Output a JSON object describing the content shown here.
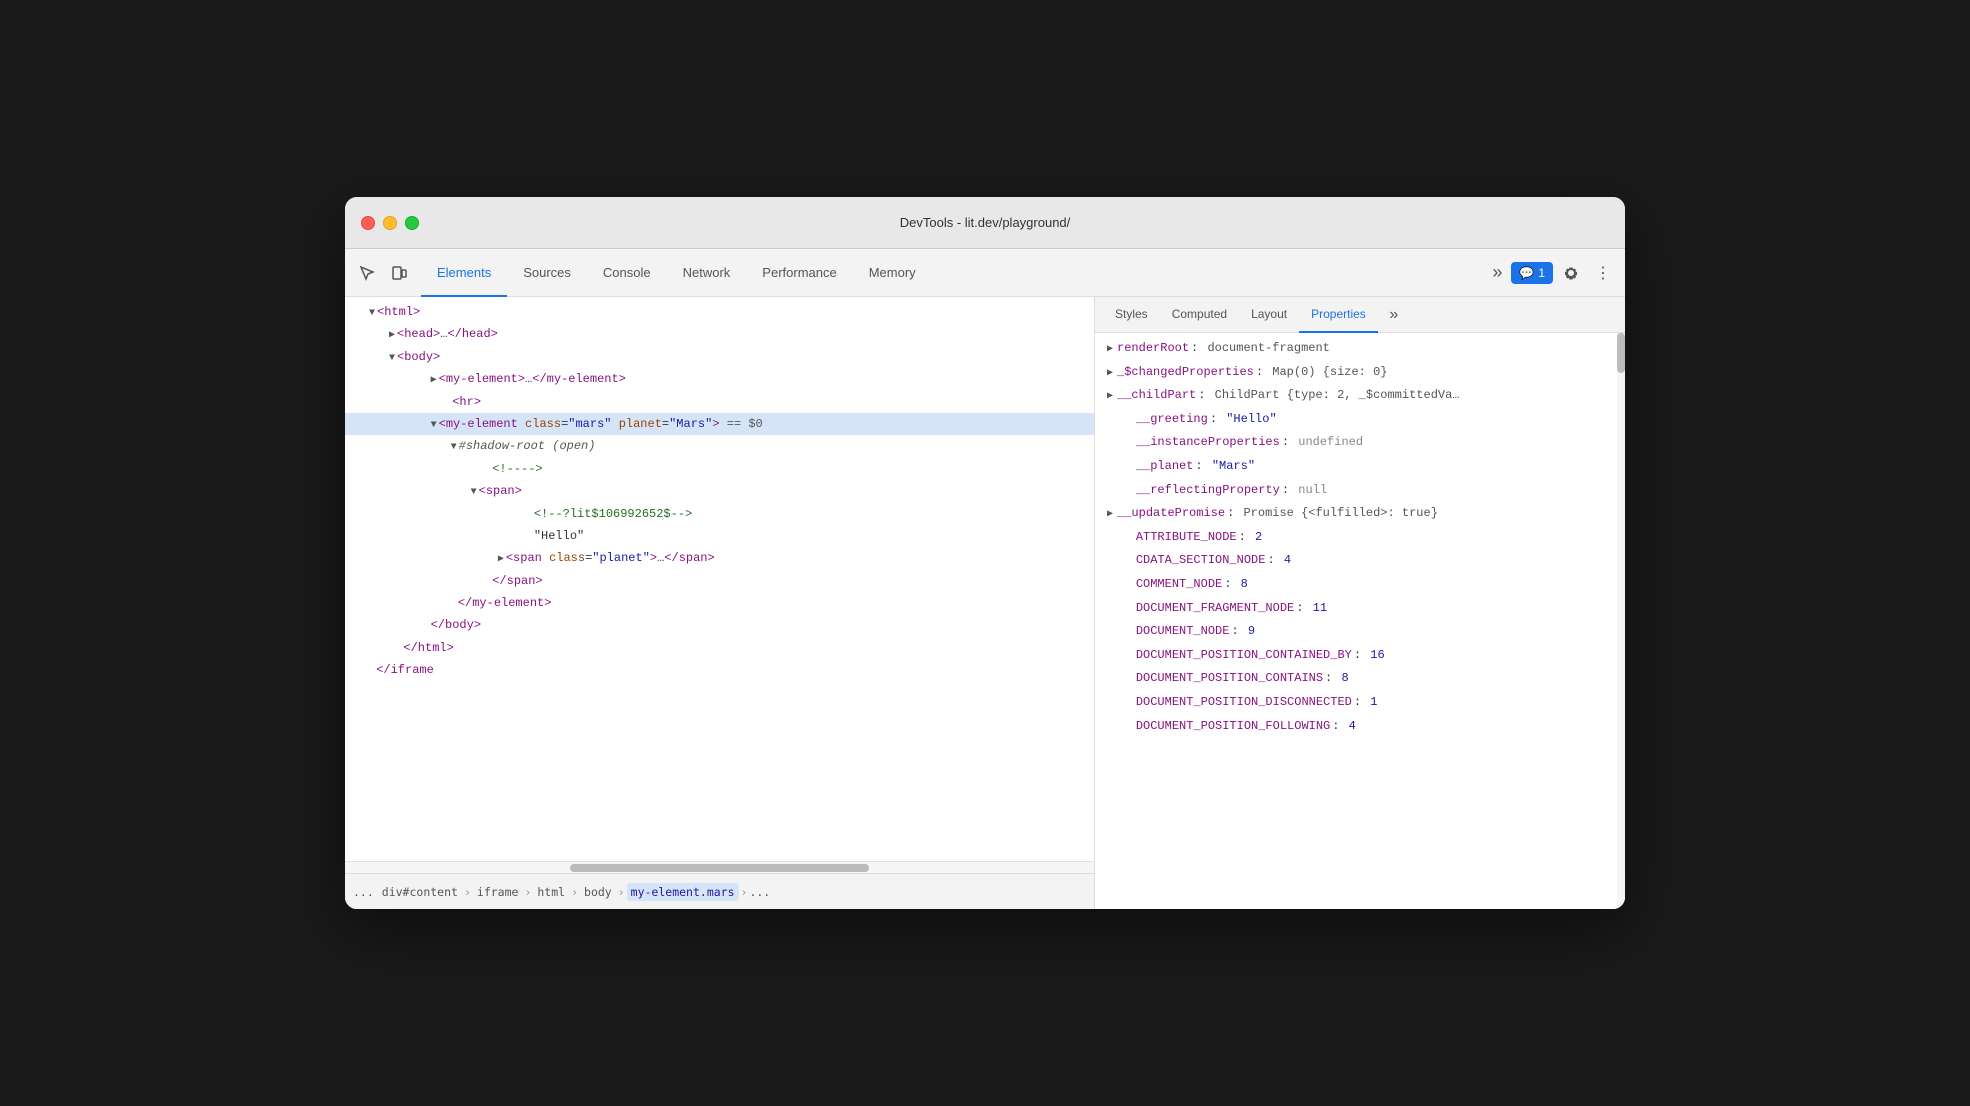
{
  "window": {
    "title": "DevTools - lit.dev/playground/"
  },
  "tabs": {
    "items": [
      {
        "label": "Elements",
        "active": true
      },
      {
        "label": "Sources"
      },
      {
        "label": "Console"
      },
      {
        "label": "Network"
      },
      {
        "label": "Performance"
      },
      {
        "label": "Memory"
      }
    ],
    "more_label": "»",
    "badge_label": "1",
    "badge_icon": "💬"
  },
  "panel_tabs": {
    "items": [
      {
        "label": "Styles"
      },
      {
        "label": "Computed"
      },
      {
        "label": "Layout"
      },
      {
        "label": "Properties",
        "active": true
      }
    ],
    "more_label": "»"
  },
  "dom_tree": [
    {
      "indent": 1,
      "content": "▼ <html>",
      "type": "tag"
    },
    {
      "indent": 2,
      "content": "▶ <head>…</head>",
      "type": "tag"
    },
    {
      "indent": 2,
      "content": "▼ <body>",
      "type": "tag"
    },
    {
      "indent": 3,
      "content": "▶ <my-element>…</my-element>",
      "type": "tag"
    },
    {
      "indent": 3,
      "content": "<hr>",
      "type": "tag"
    },
    {
      "indent": 3,
      "content": "▼ <my-element class=\"mars\" planet=\"Mars\"> == $0",
      "type": "selected"
    },
    {
      "indent": 4,
      "content": "▼ #shadow-root (open)",
      "type": "shadow"
    },
    {
      "indent": 5,
      "content": "<!---->",
      "type": "comment"
    },
    {
      "indent": 5,
      "content": "▼ <span>",
      "type": "tag"
    },
    {
      "indent": 6,
      "content": "<!--?lit$106992652$-->",
      "type": "comment"
    },
    {
      "indent": 6,
      "content": "\"Hello\"",
      "type": "text"
    },
    {
      "indent": 6,
      "content": "▶ <span class=\"planet\">…</span>",
      "type": "tag"
    },
    {
      "indent": 5,
      "content": "</span>",
      "type": "tag"
    },
    {
      "indent": 4,
      "content": "</my-element>",
      "type": "tag"
    },
    {
      "indent": 3,
      "content": "</body>",
      "type": "tag"
    },
    {
      "indent": 2,
      "content": "</html>",
      "type": "tag"
    },
    {
      "indent": 1,
      "content": "</iframe>",
      "type": "tag"
    }
  ],
  "breadcrumb": {
    "more": "...",
    "items": [
      {
        "label": "div#content"
      },
      {
        "label": "iframe"
      },
      {
        "label": "html"
      },
      {
        "label": "body"
      },
      {
        "label": "my-element.mars",
        "active": true
      },
      {
        "label": "..."
      }
    ]
  },
  "properties": [
    {
      "type": "expandable",
      "key": "renderRoot",
      "value": "document-fragment",
      "value_type": "obj"
    },
    {
      "type": "expandable",
      "key": "_$changedProperties",
      "value": "Map(0) {size: 0}",
      "value_type": "obj"
    },
    {
      "type": "expandable",
      "key": "__childPart",
      "value": "ChildPart {type: 2, _$committedVa…",
      "value_type": "obj"
    },
    {
      "type": "plain",
      "key": "__greeting",
      "value": "\"Hello\"",
      "value_type": "string"
    },
    {
      "type": "plain",
      "key": "__instanceProperties",
      "value": "undefined",
      "value_type": "null"
    },
    {
      "type": "plain",
      "key": "__planet",
      "value": "\"Mars\"",
      "value_type": "string"
    },
    {
      "type": "plain",
      "key": "__reflectingProperty",
      "value": "null",
      "value_type": "null"
    },
    {
      "type": "expandable",
      "key": "__updatePromise",
      "value": "Promise {<fulfilled>: true}",
      "value_type": "prom"
    },
    {
      "type": "plain",
      "key": "ATTRIBUTE_NODE",
      "value": "2",
      "value_type": "number"
    },
    {
      "type": "plain",
      "key": "CDATA_SECTION_NODE",
      "value": "4",
      "value_type": "number"
    },
    {
      "type": "plain",
      "key": "COMMENT_NODE",
      "value": "8",
      "value_type": "number"
    },
    {
      "type": "plain",
      "key": "DOCUMENT_FRAGMENT_NODE",
      "value": "11",
      "value_type": "number"
    },
    {
      "type": "plain",
      "key": "DOCUMENT_NODE",
      "value": "9",
      "value_type": "number"
    },
    {
      "type": "plain",
      "key": "DOCUMENT_POSITION_CONTAINED_BY",
      "value": "16",
      "value_type": "number"
    },
    {
      "type": "plain",
      "key": "DOCUMENT_POSITION_CONTAINS",
      "value": "8",
      "value_type": "number"
    },
    {
      "type": "plain",
      "key": "DOCUMENT_POSITION_DISCONNECTED",
      "value": "1",
      "value_type": "number"
    },
    {
      "type": "plain",
      "key": "DOCUMENT_POSITION_FOLLOWING",
      "value": "4",
      "value_type": "number"
    }
  ]
}
